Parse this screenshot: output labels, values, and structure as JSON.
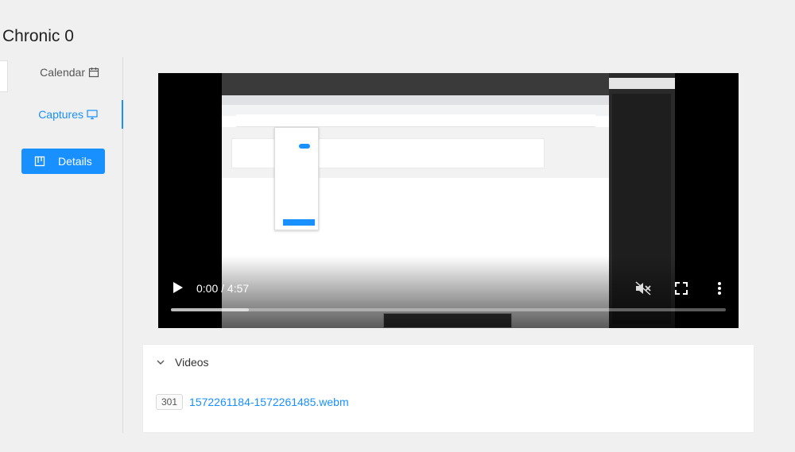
{
  "page": {
    "title": "Chronic 0"
  },
  "sidebar": {
    "items": [
      {
        "label": "Calendar",
        "icon": "calendar-icon"
      },
      {
        "label": "Captures",
        "icon": "monitor-icon",
        "active": true
      },
      {
        "label": "Details",
        "icon": "board-icon",
        "style": "primary-button"
      }
    ]
  },
  "video": {
    "time": "0:00 / 4:57",
    "buffered_fraction": 0.14,
    "muted": true,
    "controls": [
      "play-icon",
      "mute-icon",
      "fullscreen-icon",
      "more-vertical-icon"
    ]
  },
  "videos_panel": {
    "heading": "Videos",
    "expanded": true,
    "items": [
      {
        "badge": "301",
        "filename": "1572261184-1572261485.webm"
      }
    ]
  },
  "colors": {
    "accent": "#1890ff",
    "background": "#f0f0f0"
  }
}
